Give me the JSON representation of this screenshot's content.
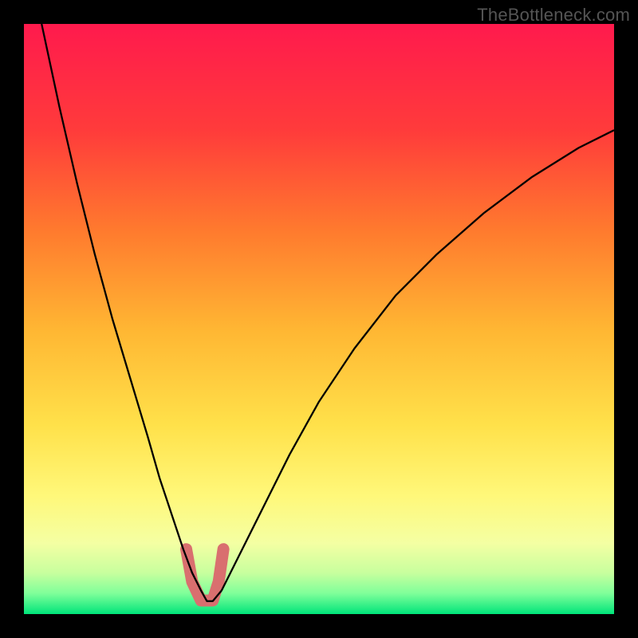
{
  "watermark": "TheBottleneck.com",
  "chart_data": {
    "type": "line",
    "title": "",
    "xlabel": "",
    "ylabel": "",
    "xlim": [
      0,
      100
    ],
    "ylim": [
      0,
      100
    ],
    "grid": false,
    "legend": false,
    "gradient_stops": [
      {
        "offset": 0,
        "color": "#ff1a4d"
      },
      {
        "offset": 0.18,
        "color": "#ff3b3b"
      },
      {
        "offset": 0.35,
        "color": "#ff7a2e"
      },
      {
        "offset": 0.52,
        "color": "#ffb733"
      },
      {
        "offset": 0.68,
        "color": "#ffe14a"
      },
      {
        "offset": 0.8,
        "color": "#fff87a"
      },
      {
        "offset": 0.88,
        "color": "#f4ffa3"
      },
      {
        "offset": 0.93,
        "color": "#c8ff9e"
      },
      {
        "offset": 0.965,
        "color": "#7fff9a"
      },
      {
        "offset": 1.0,
        "color": "#00e57a"
      }
    ],
    "series": [
      {
        "name": "bottleneck-curve",
        "color": "#000000",
        "stroke_width": 2.3,
        "x": [
          3,
          6,
          9,
          12,
          15,
          18,
          21,
          23,
          25,
          27,
          28.5,
          30,
          31,
          32,
          33.5,
          36,
          40,
          45,
          50,
          56,
          63,
          70,
          78,
          86,
          94,
          100
        ],
        "y": [
          100,
          86,
          73,
          61,
          50,
          40,
          30,
          23,
          17,
          11,
          7,
          4,
          2.2,
          2.2,
          4,
          9,
          17,
          27,
          36,
          45,
          54,
          61,
          68,
          74,
          79,
          82
        ]
      },
      {
        "name": "highlight-bottom",
        "color": "#d96f6f",
        "stroke_width": 15,
        "linecap": "round",
        "x": [
          27.5,
          28.5,
          30,
          32,
          33,
          33.8
        ],
        "y": [
          11,
          5.5,
          2.3,
          2.3,
          5.5,
          11
        ]
      }
    ]
  }
}
